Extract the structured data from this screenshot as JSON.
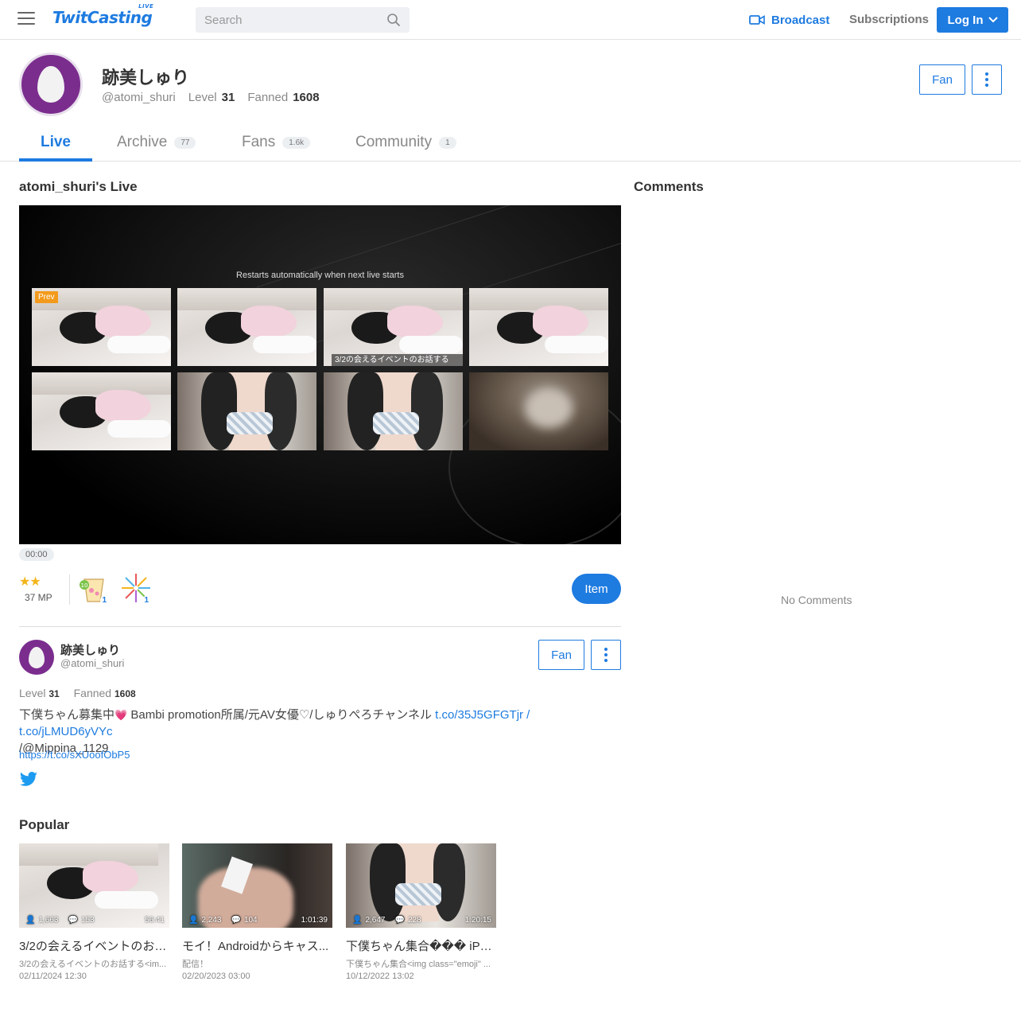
{
  "header": {
    "logo": "TwitCasting",
    "logo_live": "LIVE",
    "search_placeholder": "Search",
    "broadcast": "Broadcast",
    "subscriptions": "Subscriptions",
    "login": "Log In",
    "accent": "#1e7be0"
  },
  "profile": {
    "name": "跡美しゅり",
    "handle": "@atomi_shuri",
    "level_label": "Level",
    "level": "31",
    "fanned_label": "Fanned",
    "fanned": "1608",
    "fan_button": "Fan",
    "avatar_color": "#7b2d8e"
  },
  "tabs": [
    {
      "label": "Live",
      "badge": ""
    },
    {
      "label": "Archive",
      "badge": "77"
    },
    {
      "label": "Fans",
      "badge": "1.6k"
    },
    {
      "label": "Community",
      "badge": "1"
    }
  ],
  "live": {
    "title": "atomi_shuri's Live",
    "restarts_text": "Restarts automatically when next live starts",
    "prev_label": "Prev",
    "thumb_caption": "3/2の会えるイベントのお話する",
    "thumbnails": [
      "bed",
      "bed",
      "bed",
      "bed",
      "bed",
      "girl",
      "girl",
      "blur"
    ],
    "time": "00:00",
    "stars": "★★",
    "mp": "37 MP",
    "gifts": [
      {
        "icon": "tea-cup-icon",
        "badge": "10",
        "count": "1"
      },
      {
        "icon": "fireworks-icon",
        "count": "1"
      }
    ],
    "item_button": "Item"
  },
  "user_card": {
    "name": "跡美しゅり",
    "handle": "@atomi_shuri",
    "level_label": "Level",
    "level": "31",
    "fanned_label": "Fanned",
    "fanned": "1608",
    "fan_button": "Fan",
    "bio_text": "下僕ちゃん募集中",
    "bio_heart": "💗",
    "bio_text2": " Bambi promotion所属/元AV女優♡/しゅりぺろチャンネル ",
    "bio_link1": "t.co/35J5GFGTjr",
    "bio_sep": " / ",
    "bio_link2": "t.co/jLMUD6yVYc",
    "bio_text3": " /@Mippina_1129",
    "link": "https://t.co/sXUoofObP5"
  },
  "popular": {
    "title": "Popular",
    "items": [
      {
        "viewers": "1,663",
        "comments": "153",
        "duration": "56:41",
        "title": "3/2の会えるイベントのお話...",
        "desc": "3/2の会えるイベントのお話する<im...",
        "date": "02/11/2024 12:30",
        "thumb": "bed"
      },
      {
        "viewers": "2,243",
        "comments": "104",
        "duration": "1:01:39",
        "title": "モイ！Androidからキャス...",
        "desc": "配信！",
        "date": "02/20/2023 03:00",
        "thumb": "hand"
      },
      {
        "viewers": "2,647",
        "comments": "228",
        "duration": "1:20:15",
        "title": "下僕ちゃん集合��� iPhoneか...",
        "desc": "下僕ちゃん集合<img class=\"emoji\" ...",
        "date": "10/12/2022 13:02",
        "thumb": "girl"
      }
    ]
  },
  "comments": {
    "title": "Comments",
    "empty": "No Comments"
  }
}
